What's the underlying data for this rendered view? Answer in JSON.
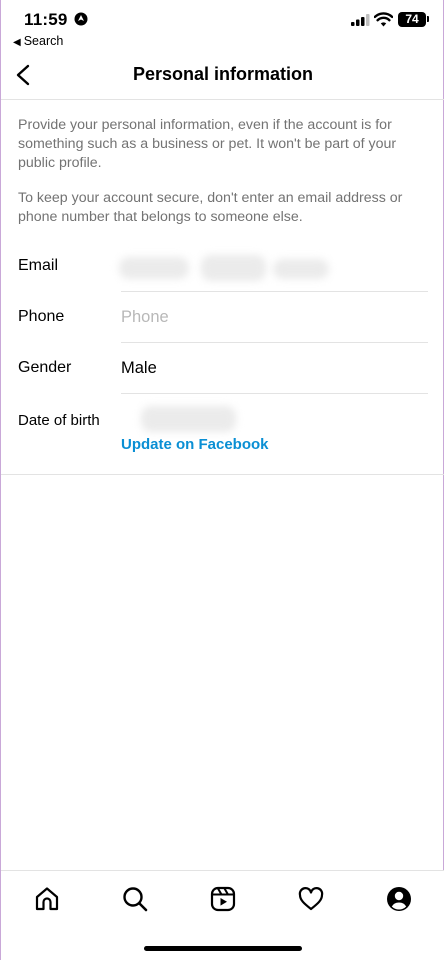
{
  "status_bar": {
    "time": "11:59",
    "back_app": "Search",
    "battery": "74"
  },
  "nav": {
    "title": "Personal information"
  },
  "intro": {
    "paragraph1": "Provide your personal information, even if the account is for something such as a business or pet. It won't be part of your public profile.",
    "paragraph2": "To keep your account secure, don't enter an email address or phone number that belongs to someone else."
  },
  "fields": {
    "email": {
      "label": "Email"
    },
    "phone": {
      "label": "Phone",
      "placeholder": "Phone"
    },
    "gender": {
      "label": "Gender",
      "value": "Male"
    },
    "dob": {
      "label": "Date of birth",
      "link": "Update on Facebook"
    }
  },
  "colors": {
    "link": "#0a8fd4",
    "secondary_text": "#737373",
    "placeholder": "#b8b8b8",
    "divider": "#e3e3e3"
  },
  "tabs": [
    {
      "icon": "home-icon"
    },
    {
      "icon": "search-icon"
    },
    {
      "icon": "reels-icon"
    },
    {
      "icon": "heart-icon"
    },
    {
      "icon": "profile-icon"
    }
  ]
}
